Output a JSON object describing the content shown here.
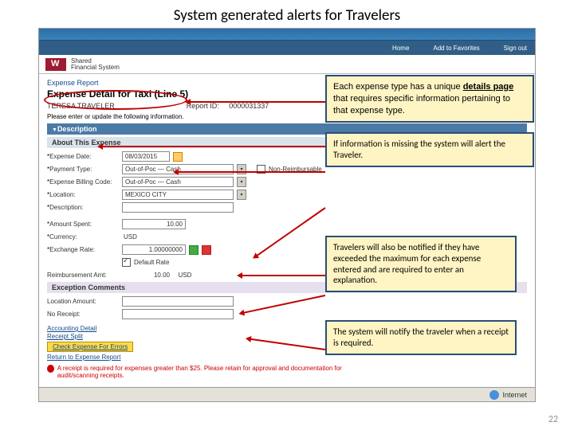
{
  "slide": {
    "title": "System generated alerts for Travelers",
    "page_number": "22"
  },
  "nav": {
    "home": "Home",
    "fav": "Add to Favorites",
    "out": "Sign out"
  },
  "brand": {
    "system_line1": "Shared",
    "system_line2": "Financial System"
  },
  "page": {
    "breadcrumb": "Expense Report",
    "title": "Expense Detail for Taxi (Line 5)",
    "traveler": "TERESA TRAVELER",
    "report_id_lbl": "Report ID:",
    "report_id": "0000031337",
    "instruction": "Please enter or update the following information.",
    "section_desc": "Description",
    "section_about": "About This Expense"
  },
  "fields": {
    "date": {
      "label": "Expense Date:",
      "value": "08/03/2015"
    },
    "ptype": {
      "label": "Payment Type:",
      "value": "Out-of-Poc — Cash"
    },
    "bcode": {
      "label": "Expense Billing Code:",
      "value": "Out-of-Poc — Cash"
    },
    "loc": {
      "label": "Location:",
      "value": "MEXICO CITY"
    },
    "desc": {
      "label": "Description:",
      "value": ""
    },
    "amount": {
      "label": "Amount Spent:",
      "value": "10.00"
    },
    "currency": {
      "label": "Currency:",
      "value": "USD"
    },
    "xrate": {
      "label": "Exchange Rate:",
      "value": "1.00000000"
    },
    "reimb": {
      "label": "Reimbursement Amt:",
      "value": "10.00",
      "ccy": "USD"
    },
    "locamt": {
      "label": "Location Amount:",
      "value": ""
    },
    "norec": {
      "label": "No Receipt:",
      "value": ""
    },
    "nonreimb": "Non-Reimbursable",
    "defrate": "Default Rate",
    "exc_comments": "Exception Comments"
  },
  "links": {
    "acct": "Accounting Detail",
    "receipt": "Receipt Split",
    "check": "Check Expense For Errors",
    "return": "Return to Expense Report"
  },
  "footer": {
    "msg": "A receipt is required for expenses greater than $25. Please retain for approval and documentation for audit/scanning receipts."
  },
  "status": {
    "zone": "Internet"
  },
  "callouts": {
    "c1a": "Each expense type has a unique ",
    "c1b": "details page",
    "c1c": " that requires specific information pertaining to that expense type.",
    "c2": "If information is missing the system will alert the Traveler.",
    "c3": "Travelers will also be notified if they have exceeded the maximum for each expense entered and are required to enter an explanation.",
    "c4": "The system will notify the traveler when a receipt is required."
  }
}
